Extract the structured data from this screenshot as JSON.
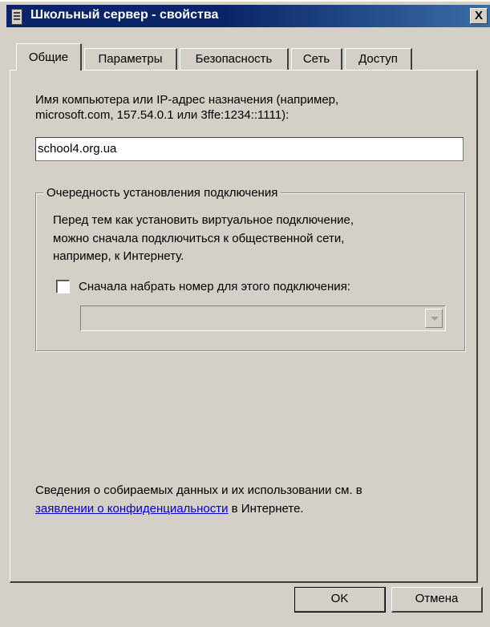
{
  "window": {
    "title": "Школьный сервер - свойства",
    "close_label": "X"
  },
  "tabs": [
    {
      "label": "Общие",
      "active": true
    },
    {
      "label": "Параметры",
      "active": false
    },
    {
      "label": "Безопасность",
      "active": false
    },
    {
      "label": "Сеть",
      "active": false
    },
    {
      "label": "Доступ",
      "active": false
    }
  ],
  "general": {
    "host_label_line1": "Имя компьютера или IP-адрес назначения (например,",
    "host_label_line2": "microsoft.com, 157.54.0.1 или 3ffe:1234::1111):",
    "host_value": "school4.org.ua",
    "group_title": "Очередность установления подключения",
    "group_desc_line1": "Перед тем как установить виртуальное подключение,",
    "group_desc_line2": "можно сначала подключиться к общественной сети,",
    "group_desc_line3": "например, к Интернету.",
    "dial_first_label": "Сначала набрать номер для этого подключения:",
    "dial_first_checked": false,
    "connection_select_value": "",
    "privacy_line1": "Сведения о собираемых данных и их использовании см. в",
    "privacy_link": "заявлении о конфиденциальности",
    "privacy_line2_suffix": " в Интернете."
  },
  "buttons": {
    "ok": "OK",
    "cancel": "Отмена"
  }
}
